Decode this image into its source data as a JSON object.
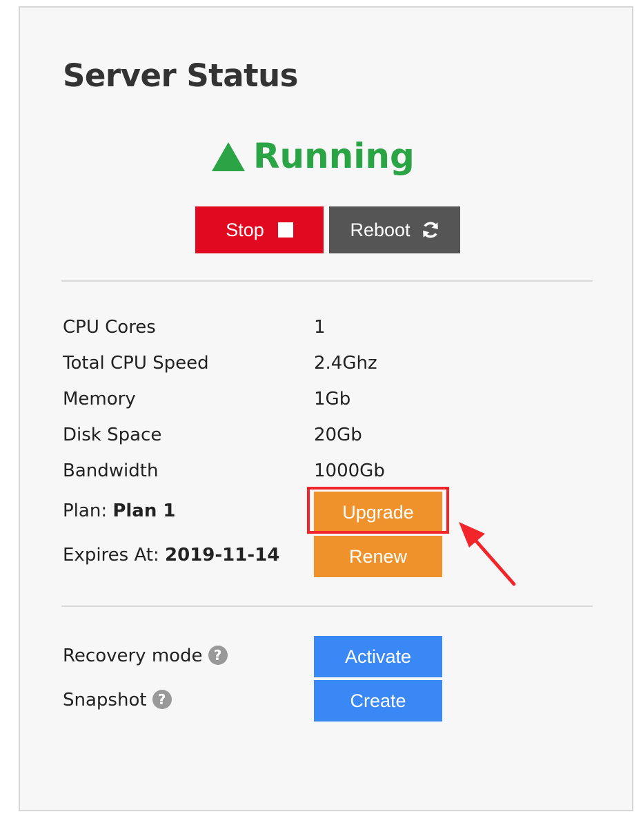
{
  "title": "Server Status",
  "status": {
    "label": "Running",
    "color": "#2ba445",
    "icon": "triangle-up-icon"
  },
  "actions": {
    "stop_label": "Stop",
    "reboot_label": "Reboot"
  },
  "specs": [
    {
      "label": "CPU Cores",
      "value": "1"
    },
    {
      "label": "Total CPU Speed",
      "value": "2.4Ghz"
    },
    {
      "label": "Memory",
      "value": "1Gb"
    },
    {
      "label": "Disk Space",
      "value": "20Gb"
    },
    {
      "label": "Bandwidth",
      "value": "1000Gb"
    }
  ],
  "plan": {
    "prefix": "Plan: ",
    "name": "Plan 1",
    "button": "Upgrade"
  },
  "expires": {
    "prefix": "Expires At: ",
    "date": "2019-11-14",
    "button": "Renew"
  },
  "recovery": {
    "label": "Recovery mode",
    "button": "Activate",
    "help_icon": "question-circle-icon"
  },
  "snapshot": {
    "label": "Snapshot",
    "button": "Create",
    "help_icon": "question-circle-icon"
  },
  "colors": {
    "stop": "#e1091f",
    "reboot": "#555555",
    "orange": "#f0922b",
    "blue": "#3a87f6",
    "highlight": "#f2262a"
  }
}
